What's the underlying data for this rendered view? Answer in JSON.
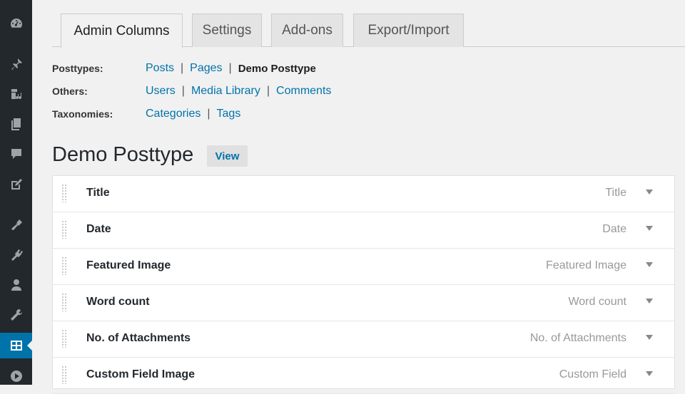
{
  "tabs": [
    {
      "label": "Admin Columns",
      "active": true
    },
    {
      "label": "Settings",
      "active": false
    },
    {
      "label": "Add-ons",
      "active": false
    },
    {
      "label": "Export/Import",
      "active": false
    }
  ],
  "nav": {
    "posttypes": {
      "label": "Posttypes:",
      "links": [
        "Posts",
        "Pages"
      ],
      "current": "Demo Posttype"
    },
    "others": {
      "label": "Others:",
      "links": [
        "Users",
        "Media Library",
        "Comments"
      ]
    },
    "taxonomies": {
      "label": "Taxonomies:",
      "links": [
        "Categories",
        "Tags"
      ]
    },
    "separator": "|"
  },
  "page": {
    "title": "Demo Posttype",
    "view_label": "View"
  },
  "columns": [
    {
      "name": "Title",
      "type": "Title"
    },
    {
      "name": "Date",
      "type": "Date"
    },
    {
      "name": "Featured Image",
      "type": "Featured Image"
    },
    {
      "name": "Word count",
      "type": "Word count"
    },
    {
      "name": "No. of Attachments",
      "type": "No. of Attachments"
    },
    {
      "name": "Custom Field Image",
      "type": "Custom Field"
    }
  ],
  "sidebar_icons": [
    "dashboard-icon",
    "pin-icon",
    "media-icon",
    "pages-icon",
    "comments-icon",
    "edit-icon",
    "appearance-icon",
    "plugins-icon",
    "users-icon",
    "tools-icon",
    "admin-columns-icon",
    "play-icon"
  ],
  "colors": {
    "accent": "#0073aa",
    "sidebar": "#23282d",
    "background": "#f1f1f1"
  }
}
